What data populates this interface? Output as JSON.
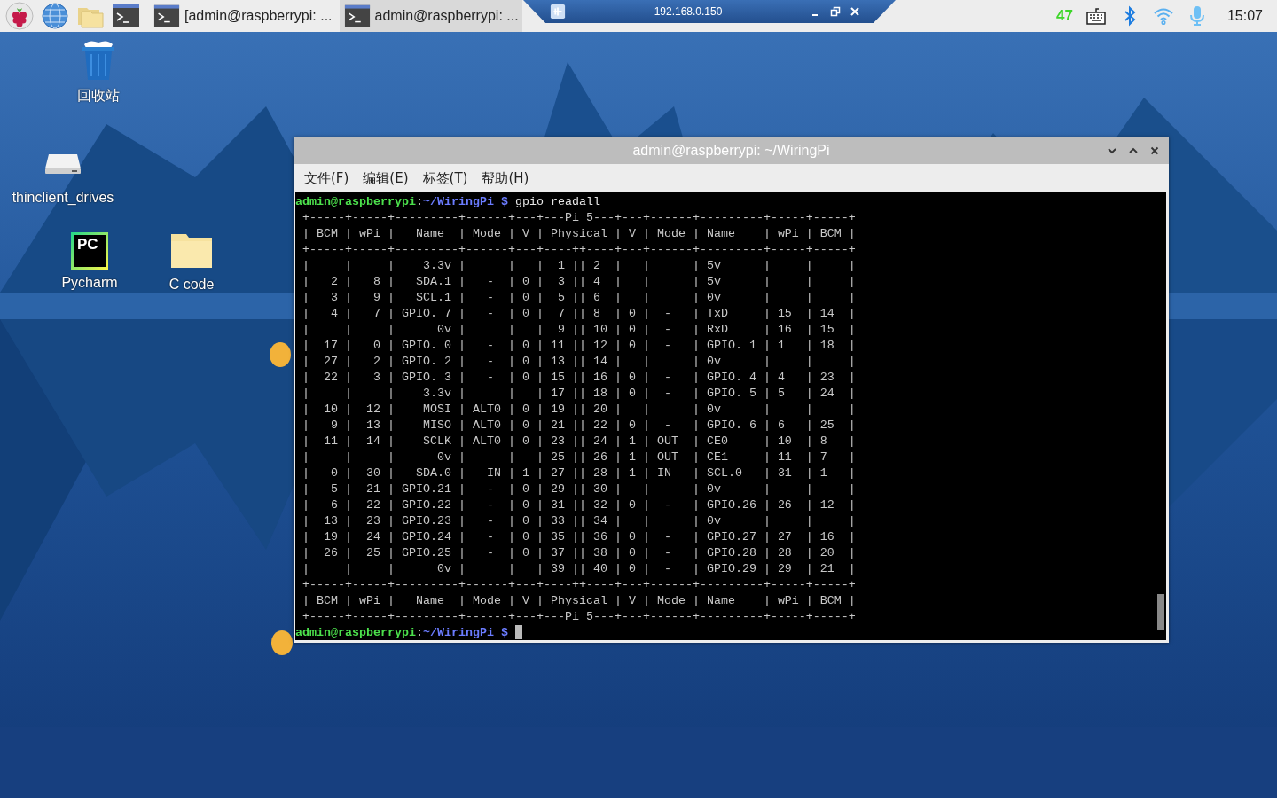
{
  "taskbar": {
    "tasks": [
      {
        "title": "[admin@raspberrypi: ...",
        "selected": false
      },
      {
        "title": "admin@raspberrypi: ...",
        "selected": true
      }
    ],
    "remote_bar": {
      "host": "192.168.0.150"
    },
    "cpu": "47",
    "clock": "15:07"
  },
  "desktop_icons": [
    {
      "label": "回收站",
      "kind": "trash"
    },
    {
      "label": "thinclient_drives",
      "kind": "drive"
    },
    {
      "label": "Pycharm",
      "kind": "pycharm",
      "logo": "PC"
    },
    {
      "label": "C code",
      "kind": "folder"
    }
  ],
  "terminal": {
    "title": "admin@raspberrypi: ~/WiringPi",
    "menu": [
      "文件(F)",
      "编辑(E)",
      "标签(T)",
      "帮助(H)"
    ],
    "lines": [
      {
        "kind": "prompt",
        "user": "admin@raspberrypi",
        "separator": ":",
        "path": "~/WiringPi $",
        "command": "gpio readall"
      },
      {
        "kind": "output",
        "text": " +-----+-----+---------+------+---+---Pi 5---+---+------+---------+-----+-----+"
      },
      {
        "kind": "output",
        "text": " | BCM | wPi |   Name  | Mode | V | Physical | V | Mode | Name    | wPi | BCM |"
      },
      {
        "kind": "output",
        "text": " +-----+-----+---------+------+---+----++----+---+------+---------+-----+-----+"
      },
      {
        "kind": "output",
        "text": " |     |     |    3.3v |      |   |  1 || 2  |   |      | 5v      |     |     |"
      },
      {
        "kind": "output",
        "text": " |   2 |   8 |   SDA.1 |   -  | 0 |  3 || 4  |   |      | 5v      |     |     |"
      },
      {
        "kind": "output",
        "text": " |   3 |   9 |   SCL.1 |   -  | 0 |  5 || 6  |   |      | 0v      |     |     |"
      },
      {
        "kind": "output",
        "text": " |   4 |   7 | GPIO. 7 |   -  | 0 |  7 || 8  | 0 |  -   | TxD     | 15  | 14  |"
      },
      {
        "kind": "output",
        "text": " |     |     |      0v |      |   |  9 || 10 | 0 |  -   | RxD     | 16  | 15  |"
      },
      {
        "kind": "output",
        "text": " |  17 |   0 | GPIO. 0 |   -  | 0 | 11 || 12 | 0 |  -   | GPIO. 1 | 1   | 18  |"
      },
      {
        "kind": "output",
        "text": " |  27 |   2 | GPIO. 2 |   -  | 0 | 13 || 14 |   |      | 0v      |     |     |"
      },
      {
        "kind": "output",
        "text": " |  22 |   3 | GPIO. 3 |   -  | 0 | 15 || 16 | 0 |  -   | GPIO. 4 | 4   | 23  |"
      },
      {
        "kind": "output",
        "text": " |     |     |    3.3v |      |   | 17 || 18 | 0 |  -   | GPIO. 5 | 5   | 24  |"
      },
      {
        "kind": "output",
        "text": " |  10 |  12 |    MOSI | ALT0 | 0 | 19 || 20 |   |      | 0v      |     |     |"
      },
      {
        "kind": "output",
        "text": " |   9 |  13 |    MISO | ALT0 | 0 | 21 || 22 | 0 |  -   | GPIO. 6 | 6   | 25  |"
      },
      {
        "kind": "output",
        "text": " |  11 |  14 |    SCLK | ALT0 | 0 | 23 || 24 | 1 | OUT  | CE0     | 10  | 8   |"
      },
      {
        "kind": "output",
        "text": " |     |     |      0v |      |   | 25 || 26 | 1 | OUT  | CE1     | 11  | 7   |"
      },
      {
        "kind": "output",
        "text": " |   0 |  30 |   SDA.0 |   IN | 1 | 27 || 28 | 1 | IN   | SCL.0   | 31  | 1   |"
      },
      {
        "kind": "output",
        "text": " |   5 |  21 | GPIO.21 |   -  | 0 | 29 || 30 |   |      | 0v      |     |     |"
      },
      {
        "kind": "output",
        "text": " |   6 |  22 | GPIO.22 |   -  | 0 | 31 || 32 | 0 |  -   | GPIO.26 | 26  | 12  |"
      },
      {
        "kind": "output",
        "text": " |  13 |  23 | GPIO.23 |   -  | 0 | 33 || 34 |   |      | 0v      |     |     |"
      },
      {
        "kind": "output",
        "text": " |  19 |  24 | GPIO.24 |   -  | 0 | 35 || 36 | 0 |  -   | GPIO.27 | 27  | 16  |"
      },
      {
        "kind": "output",
        "text": " |  26 |  25 | GPIO.25 |   -  | 0 | 37 || 38 | 0 |  -   | GPIO.28 | 28  | 20  |"
      },
      {
        "kind": "output",
        "text": " |     |     |      0v |      |   | 39 || 40 | 0 |  -   | GPIO.29 | 29  | 21  |"
      },
      {
        "kind": "output",
        "text": " +-----+-----+---------+------+---+----++----+---+------+---------+-----+-----+"
      },
      {
        "kind": "output",
        "text": " | BCM | wPi |   Name  | Mode | V | Physical | V | Mode | Name    | wPi | BCM |"
      },
      {
        "kind": "output",
        "text": " +-----+-----+---------+------+---+---Pi 5---+---+------+---------+-----+-----+"
      },
      {
        "kind": "prompt",
        "user": "admin@raspberrypi",
        "separator": ":",
        "path": "~/WiringPi $",
        "cursor": true
      }
    ]
  }
}
